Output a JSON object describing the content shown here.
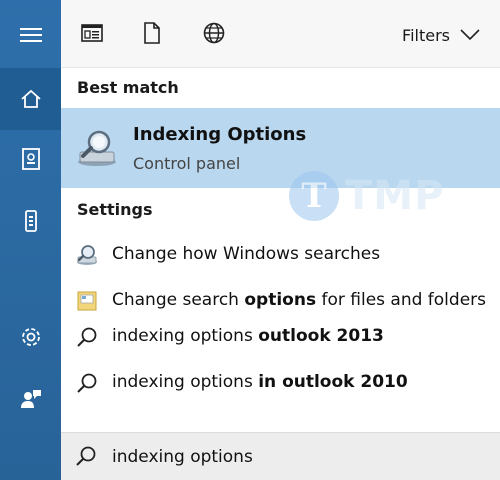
{
  "topbar": {
    "filters_label": "Filters"
  },
  "sections": {
    "best_match": "Best match",
    "settings": "Settings"
  },
  "best_match": {
    "title": "Indexing Options",
    "subtitle": "Control panel"
  },
  "settings_items": [
    {
      "prefix": "Change how Windows searches",
      "bold": "",
      "suffix": ""
    },
    {
      "prefix": "Change search ",
      "bold": "options",
      "suffix": " for files and folders"
    }
  ],
  "web_items": [
    {
      "prefix": "indexing options ",
      "bold": "outlook 2013",
      "suffix": ""
    },
    {
      "prefix": "indexing options ",
      "bold": "in outlook 2010",
      "suffix": ""
    }
  ],
  "search": {
    "value": "indexing options"
  },
  "watermark": {
    "letter": "T",
    "text": "TMP"
  },
  "colors": {
    "rail": "#2a6aa6",
    "rail_active": "#1f5d93",
    "highlight": "#b9d7ef"
  },
  "icons": {
    "rail": [
      "hamburger-icon",
      "home-icon",
      "notebook-icon",
      "phone-icon",
      "gear-icon",
      "feedback-icon"
    ],
    "topbar": [
      "apps-icon",
      "document-icon",
      "globe-icon",
      "chevron-down-icon"
    ],
    "results": [
      "indexing-options-icon",
      "search-settings-icon",
      "folder-options-icon",
      "search-icon"
    ]
  }
}
